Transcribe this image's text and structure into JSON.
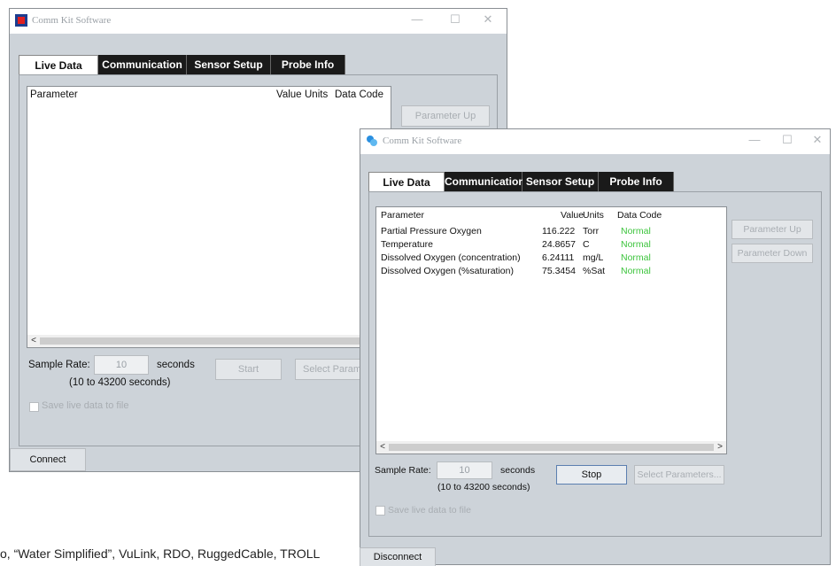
{
  "window1": {
    "title": "Comm Kit Software",
    "controls": [
      "—",
      "☐",
      "✕"
    ],
    "tabs": [
      "Live Data",
      "Communication",
      "Sensor Setup",
      "Probe Info"
    ],
    "list_headers": {
      "parameter": "Parameter",
      "value": "Value",
      "units": "Units",
      "data_code": "Data Code"
    },
    "scroll_left": "<",
    "parameter_up": "Parameter Up",
    "sample_rate_label": "Sample Rate:",
    "sample_rate_value": "10",
    "seconds_label": "seconds",
    "range_label": "(10 to 43200 seconds)",
    "start_button": "Start",
    "select_params_button": "Select Param",
    "save_live_label": "Save live data to file",
    "connect_button": "Connect"
  },
  "window2": {
    "title": "Comm Kit Software",
    "controls": [
      "—",
      "☐",
      "✕"
    ],
    "tabs": [
      "Live Data",
      "Communication",
      "Sensor Setup",
      "Probe Info"
    ],
    "list_headers": {
      "parameter": "Parameter",
      "value": "Value",
      "units": "Units",
      "data_code": "Data Code"
    },
    "rows": [
      {
        "parameter": "Partial Pressure Oxygen",
        "value": "116.222",
        "units": "Torr",
        "code": "Normal"
      },
      {
        "parameter": "Temperature",
        "value": "24.8657",
        "units": "C",
        "code": "Normal"
      },
      {
        "parameter": "Dissolved Oxygen (concentration)",
        "value": "6.24111",
        "units": "mg/L",
        "code": "Normal"
      },
      {
        "parameter": "Dissolved Oxygen (%saturation)",
        "value": "75.3454",
        "units": "%Sat",
        "code": "Normal"
      }
    ],
    "scroll_left": "<",
    "scroll_right": ">",
    "parameter_up": "Parameter Up",
    "parameter_down": "Parameter Down",
    "sample_rate_label": "Sample Rate:",
    "sample_rate_value": "10",
    "seconds_label": "seconds",
    "range_label": "(10 to 43200 seconds)",
    "stop_button": "Stop",
    "select_params_button": "Select Parameters...",
    "save_live_label": "Save live data to file",
    "disconnect_button": "Disconnect"
  },
  "caption": "o, “Water Simplified”, VuLink, RDO, RuggedCable, TROLL",
  "colors": {
    "normal_status": "#3cc43c",
    "tab_dark": "#1a1a1a",
    "window_bg": "#cdd3d9"
  }
}
